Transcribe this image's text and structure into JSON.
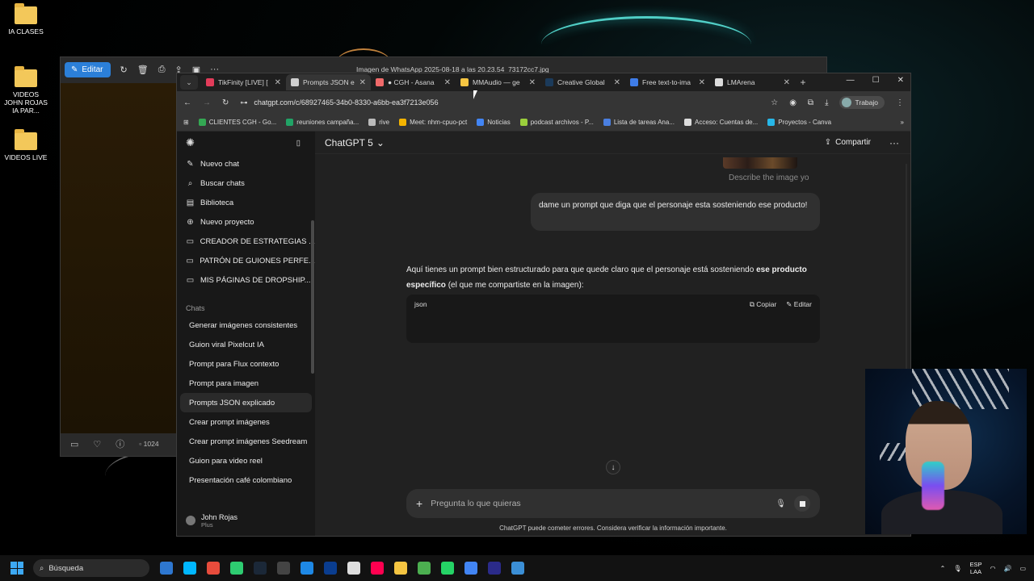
{
  "desktop": {
    "icons": [
      {
        "label": "IA CLASES",
        "icon": "folder-icon"
      },
      {
        "label": "VIDEOS JOHN ROJAS IA PAR...",
        "icon": "folder-icon"
      },
      {
        "label": "VIDEOS LIVE",
        "icon": "folder-icon"
      }
    ]
  },
  "viewer": {
    "edit_label": "Editar",
    "title": "Imagen de WhatsApp 2025-08-18 a las 20.23.54_73172cc7.jpg",
    "zoom": "1024"
  },
  "browser": {
    "tabs": [
      {
        "title": "TikFinity [LIVE] [",
        "color": "#e23c5a",
        "active": false
      },
      {
        "title": "Prompts JSON e",
        "color": "#cfcfcf",
        "active": true
      },
      {
        "title": "● CGH - Asana",
        "color": "#f06a6a",
        "active": false
      },
      {
        "title": "MMAudio — ge",
        "color": "#f5c542",
        "active": false
      },
      {
        "title": "Creative Global",
        "color": "#1b3a5a",
        "active": false
      },
      {
        "title": "Free text-to-ima",
        "color": "#3f7de8",
        "active": false
      },
      {
        "title": "LMArena",
        "color": "#dcdcdc",
        "active": false
      }
    ],
    "url": "chatgpt.com/c/68927465-34b0-8330-a6bb-ea3f7213e056",
    "profile_label": "Trabajo",
    "bookmarks": [
      {
        "label": "CLIENTES CGH - Go...",
        "color": "#34a853"
      },
      {
        "label": "reuniones campaña...",
        "color": "#21a366"
      },
      {
        "label": "rive",
        "color": "#bbbbbb"
      },
      {
        "label": "Meet: nhm-cpuo-pct",
        "color": "#f4b400"
      },
      {
        "label": "Noticias",
        "color": "#4285f4"
      },
      {
        "label": "podcast archivos - P...",
        "color": "#9bcf3c"
      },
      {
        "label": "Lista de tareas Ana...",
        "color": "#4a7fe0"
      },
      {
        "label": "Acceso: Cuentas de...",
        "color": "#dddddd"
      },
      {
        "label": "Proyectos - Canva",
        "color": "#27b7e8"
      }
    ]
  },
  "sidebar": {
    "top_items": [
      {
        "label": "Nuevo chat",
        "icon": "edit-icon"
      },
      {
        "label": "Buscar chats",
        "icon": "search-icon"
      },
      {
        "label": "Biblioteca",
        "icon": "library-icon"
      },
      {
        "label": "Nuevo proyecto",
        "icon": "folder-plus-icon"
      },
      {
        "label": "CREADOR DE ESTRATEGIAS ...",
        "icon": "folder-icon"
      },
      {
        "label": "PATRÓN DE GUIONES PERFE...",
        "icon": "folder-icon"
      },
      {
        "label": "MIS PÁGINAS DE DROPSHIP...",
        "icon": "folder-icon"
      }
    ],
    "chats_heading": "Chats",
    "chats": [
      "Generar imágenes consistentes",
      "Guion viral Pixelcut IA",
      "Prompt para Flux contexto",
      "Prompt para imagen",
      "Prompts JSON explicado",
      "Crear prompt imágenes",
      "Crear prompt imágenes Seedream",
      "Guion para video reel",
      "Presentación café colombiano"
    ],
    "active_chat_index": 4,
    "user": {
      "name": "John Rojas",
      "plan": "Plus"
    }
  },
  "chat": {
    "model": "ChatGPT 5",
    "share_label": "Compartir",
    "image_caption": "Describe the image yo",
    "user_message": "dame un prompt que diga que el personaje esta sosteniendo ese producto!",
    "answer_prefix": "Aquí tienes un prompt bien estructurado para que quede claro que el personaje está sosteniendo ",
    "answer_bold": "ese producto específico",
    "answer_suffix": " (el que me compartiste en la imagen):",
    "code_lang": "json",
    "copy_label": "Copiar",
    "edit_label": "Editar",
    "composer_placeholder": "Pregunta lo que quieras",
    "disclaimer": "ChatGPT puede cometer errores. Considera verificar la información importante."
  },
  "taskbar": {
    "search_label": "Búsqueda",
    "lang_top": "ESP",
    "lang_bottom": "LAA",
    "apps": [
      "#2e77d0",
      "#00b7ff",
      "#e74c3c",
      "#2ecc71",
      "#1b2838",
      "#444444",
      "#1e88e5",
      "#0a3d8f",
      "#dddddd",
      "#ff0050",
      "#f5c542",
      "#4caf50",
      "#25d366",
      "#4285f4",
      "#2b2b8a",
      "#3b8fd6"
    ]
  }
}
